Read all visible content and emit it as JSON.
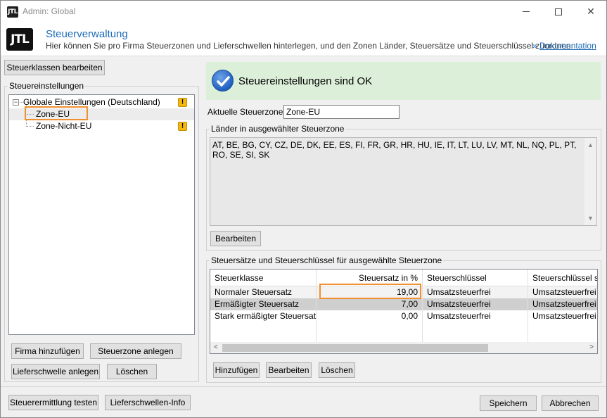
{
  "window": {
    "app_icon": "JTL",
    "title": "Admin: Global",
    "minimize_icon": "minimize-icon",
    "maximize_icon": "maximize-icon",
    "close_icon": "close-icon",
    "close_glyph": "✕"
  },
  "header": {
    "logo": "JTL",
    "title": "Steuerverwaltung",
    "description": "Hier können Sie pro Firma Steuerzonen und Lieferschwellen hinterlegen, und den Zonen Länder, Steuersätze und Steuerschlüssel zuordnen.",
    "doc_prefix": "»",
    "doc_link": "Dokumentation"
  },
  "left": {
    "edit_tax_classes_button": "Steuerklassen bearbeiten",
    "group_label": "Steuereinstellungen",
    "tree": {
      "expander": "−",
      "root": "Globale Einstellungen (Deutschland)",
      "children": [
        "Zone-EU",
        "Zone-Nicht-EU"
      ],
      "warning_glyph": "!"
    },
    "buttons": {
      "add_company": "Firma hinzufügen",
      "add_tax_zone": "Steuerzone anlegen",
      "add_delivery_threshold": "Lieferschwelle anlegen",
      "delete": "Löschen"
    }
  },
  "right": {
    "status_text": "Steuereinstellungen sind OK",
    "status_color": "#dcefd9",
    "current_zone_label": "Aktuelle Steuerzone:",
    "current_zone_value": "Zone-EU",
    "countries_group_label": "Länder in ausgewählter Steuerzone",
    "countries_text": "AT, BE, BG, CY, CZ, DE, DK, EE, ES, FI, FR, GR, HR, HU, IE, IT, LT, LU, LV, MT, NL, NQ, PL, PT, RO, SE, SI, SK",
    "countries_edit_button": "Bearbeiten",
    "rates_group_label": "Steuersätze und Steuerschlüssel für ausgewählte Steuerzone",
    "table": {
      "headers": [
        "Steuerklasse",
        "Steuersatz in %",
        "Steuerschlüssel",
        "Steuerschlüssel steu"
      ],
      "rows": [
        [
          "Normaler Steuersatz",
          "19,00",
          "Umsatzsteuerfrei",
          "Umsatzsteuerfrei"
        ],
        [
          "Ermäßigter Steuersatz",
          "7,00",
          "Umsatzsteuerfrei",
          "Umsatzsteuerfrei"
        ],
        [
          "Stark ermäßigter Steuersatz",
          "0,00",
          "Umsatzsteuerfrei",
          "Umsatzsteuerfrei"
        ]
      ]
    },
    "scroll_left": "<",
    "scroll_right": ">",
    "scroll_up": "▲",
    "scroll_down": "▼",
    "buttons": {
      "add": "Hinzufügen",
      "edit": "Bearbeiten",
      "delete": "Löschen"
    }
  },
  "footer": {
    "test_tax_button": "Steuerermittlung testen",
    "threshold_info_button": "Lieferschwellen-Info",
    "save_button": "Speichern",
    "cancel_button": "Abbrechen"
  },
  "accent_color": "#f0902f"
}
